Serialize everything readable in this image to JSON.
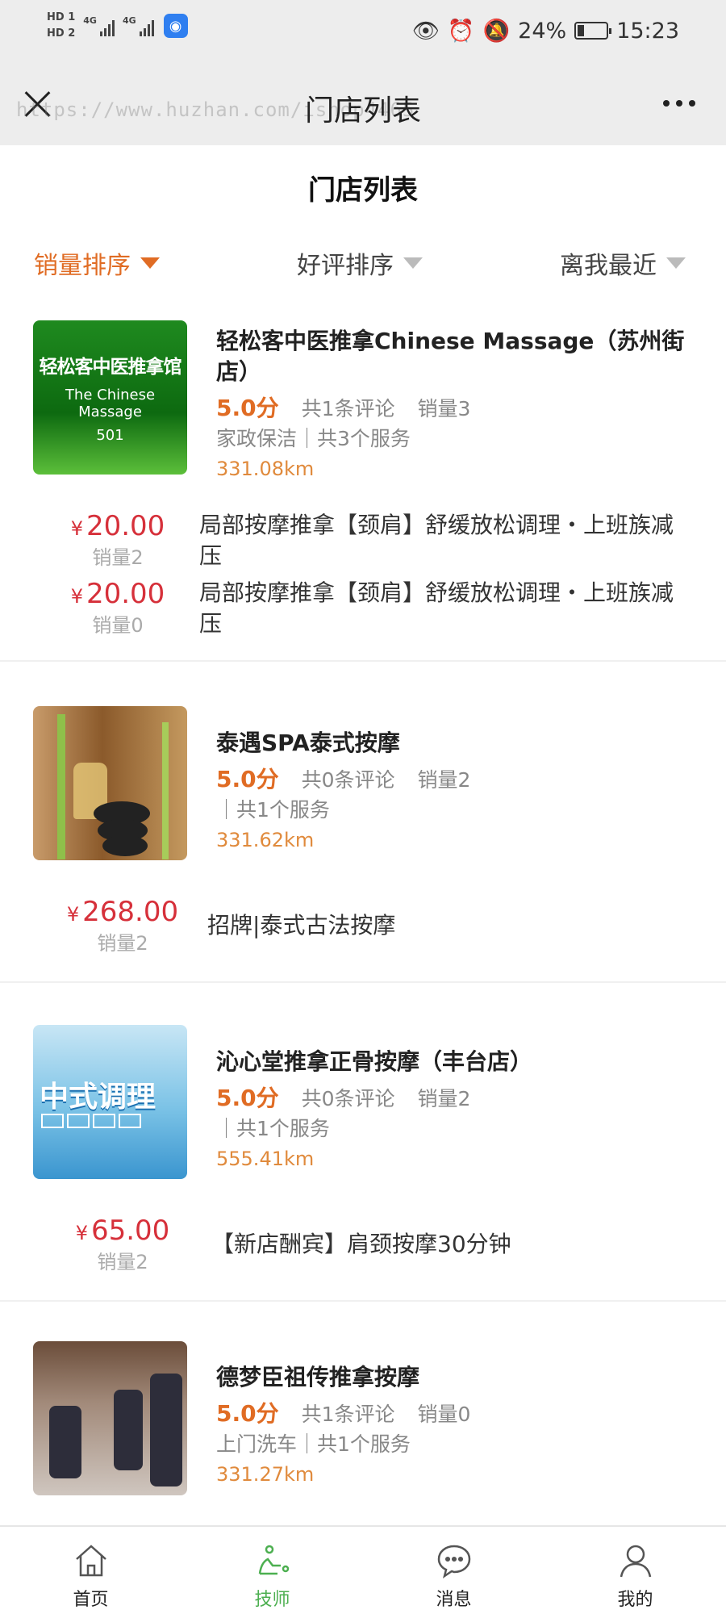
{
  "status_bar": {
    "hd1": "HD 1",
    "hd2": "HD 2",
    "net1": "4G",
    "net2": "4G",
    "battery": "24%",
    "battery_level": 0.24,
    "time": "15:23"
  },
  "title_bar": {
    "title": "门店列表",
    "watermark": "https://www.huzhan.com/ishop4465"
  },
  "page": {
    "title": "门店列表"
  },
  "sort": [
    {
      "label": "销量排序",
      "active": true
    },
    {
      "label": "好评排序",
      "active": false
    },
    {
      "label": "离我最近",
      "active": false
    }
  ],
  "stores": [
    {
      "name": "轻松客中医推拿Chinese Massage（苏州街店）",
      "score": "5.0分",
      "reviews": "共1条评论",
      "sales": "销量3",
      "category": "家政保洁｜共3个服务",
      "distance": "331.08km",
      "thumb_text": {
        "line1": "轻松客中医推拿馆",
        "line2": "The Chinese Massage",
        "line3": "501"
      },
      "services": [
        {
          "price": "20.00",
          "sold": "销量2",
          "name": "局部按摩推拿【颈肩】舒缓放松调理・上班族减压"
        },
        {
          "price": "20.00",
          "sold": "销量0",
          "name": "局部按摩推拿【颈肩】舒缓放松调理・上班族减压"
        }
      ]
    },
    {
      "name": "泰遇SPA泰式按摩",
      "score": "5.0分",
      "reviews": "共0条评论",
      "sales": "销量2",
      "category": "｜共1个服务",
      "distance": "331.62km",
      "services": [
        {
          "price": "268.00",
          "sold": "销量2",
          "name": "招牌|泰式古法按摩"
        }
      ]
    },
    {
      "name": "沁心堂推拿正骨按摩（丰台店）",
      "score": "5.0分",
      "reviews": "共0条评论",
      "sales": "销量2",
      "category": "｜共1个服务",
      "distance": "555.41km",
      "thumb_text": {
        "line1": "中式调理"
      },
      "services": [
        {
          "price": "65.00",
          "sold": "销量2",
          "name": "【新店酬宾】肩颈按摩30分钟"
        }
      ]
    },
    {
      "name": "德梦臣祖传推拿按摩",
      "score": "5.0分",
      "reviews": "共1条评论",
      "sales": "销量0",
      "category": "上门洗车｜共1个服务",
      "distance": "331.27km",
      "services": []
    }
  ],
  "currency_symbol": "¥",
  "tabs": [
    {
      "label": "首页",
      "icon": "home-icon",
      "active": false
    },
    {
      "label": "技师",
      "icon": "technician-icon",
      "active": true
    },
    {
      "label": "消息",
      "icon": "message-icon",
      "active": false
    },
    {
      "label": "我的",
      "icon": "profile-icon",
      "active": false
    }
  ],
  "colors": {
    "accent": "#e06c24",
    "price": "#d6303a",
    "tab_active": "#4caf50",
    "distance": "#e08a3c"
  }
}
